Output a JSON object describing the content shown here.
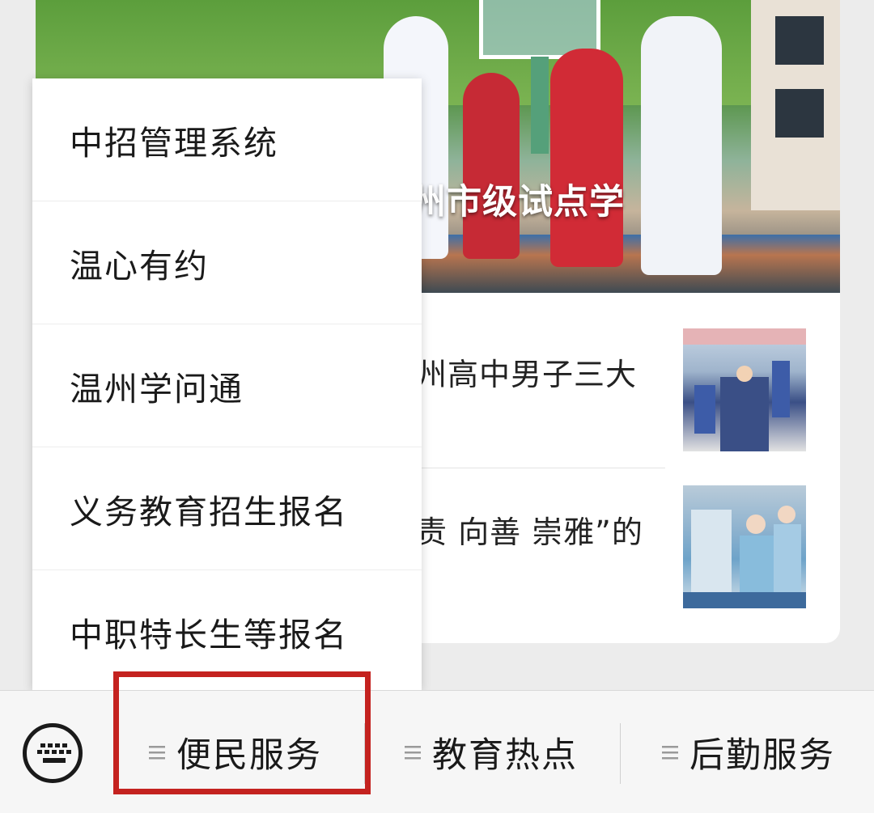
{
  "hero": {
    "caption": "批学校为温州市级试点学"
  },
  "news": [
    {
      "title": "州高中男子三大"
    },
    {
      "title": "责 向善 崇雅”的"
    }
  ],
  "menu": {
    "items": [
      "中招管理系统",
      "温心有约",
      "温州学问通",
      "义务教育招生报名",
      "中职特长生等报名"
    ]
  },
  "bottom_bar": {
    "keyboard_icon": "keyboard-icon",
    "menu_icon": "hamburger-icon",
    "tabs": [
      "便民服务",
      "教育热点",
      "后勤服务"
    ],
    "highlight_color": "#c4221f"
  }
}
